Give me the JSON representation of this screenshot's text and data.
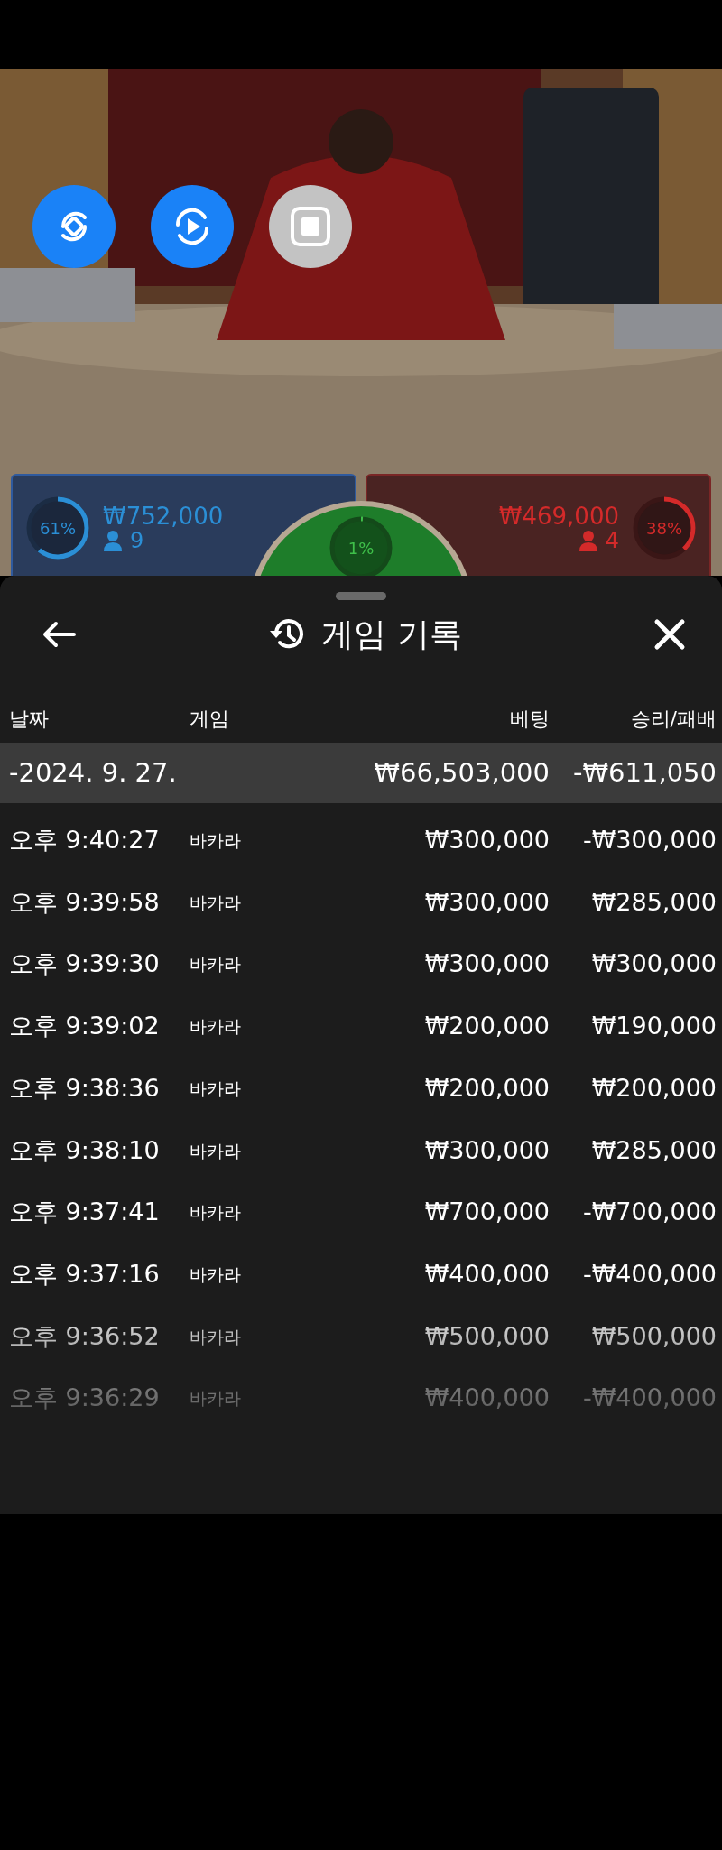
{
  "video_controls": [
    {
      "kind": "rotate",
      "on": true
    },
    {
      "kind": "replay",
      "on": true
    },
    {
      "kind": "stop",
      "on": false
    }
  ],
  "bet_panel": {
    "player": {
      "percent": "61%",
      "level": 0.61,
      "amount": "₩752,000",
      "players": "9"
    },
    "banker": {
      "percent": "38%",
      "level": 0.38,
      "amount": "₩469,000",
      "players": "4"
    },
    "tie": {
      "percent": "1%",
      "level": 0.01
    }
  },
  "sheet": {
    "title": "게임 기록",
    "columns": [
      "날짜",
      "게임",
      "베팅",
      "승리/패배"
    ],
    "date_row": {
      "date": "-2024. 9. 27.",
      "bet": "₩66,503,000",
      "result": "-₩611,050"
    },
    "rows": [
      {
        "time": "오후 9:40:27",
        "game": "바카라",
        "bet": "₩300,000",
        "result": "-₩300,000"
      },
      {
        "time": "오후 9:39:58",
        "game": "바카라",
        "bet": "₩300,000",
        "result": "₩285,000"
      },
      {
        "time": "오후 9:39:30",
        "game": "바카라",
        "bet": "₩300,000",
        "result": "₩300,000"
      },
      {
        "time": "오후 9:39:02",
        "game": "바카라",
        "bet": "₩200,000",
        "result": "₩190,000"
      },
      {
        "time": "오후 9:38:36",
        "game": "바카라",
        "bet": "₩200,000",
        "result": "₩200,000"
      },
      {
        "time": "오후 9:38:10",
        "game": "바카라",
        "bet": "₩300,000",
        "result": "₩285,000"
      },
      {
        "time": "오후 9:37:41",
        "game": "바카라",
        "bet": "₩700,000",
        "result": "-₩700,000"
      },
      {
        "time": "오후 9:37:16",
        "game": "바카라",
        "bet": "₩400,000",
        "result": "-₩400,000"
      },
      {
        "time": "오후 9:36:52",
        "game": "바카라",
        "bet": "₩500,000",
        "result": "₩500,000"
      },
      {
        "time": "오후 9:36:29",
        "game": "바카라",
        "bet": "₩400,000",
        "result": "-₩400,000"
      }
    ]
  }
}
